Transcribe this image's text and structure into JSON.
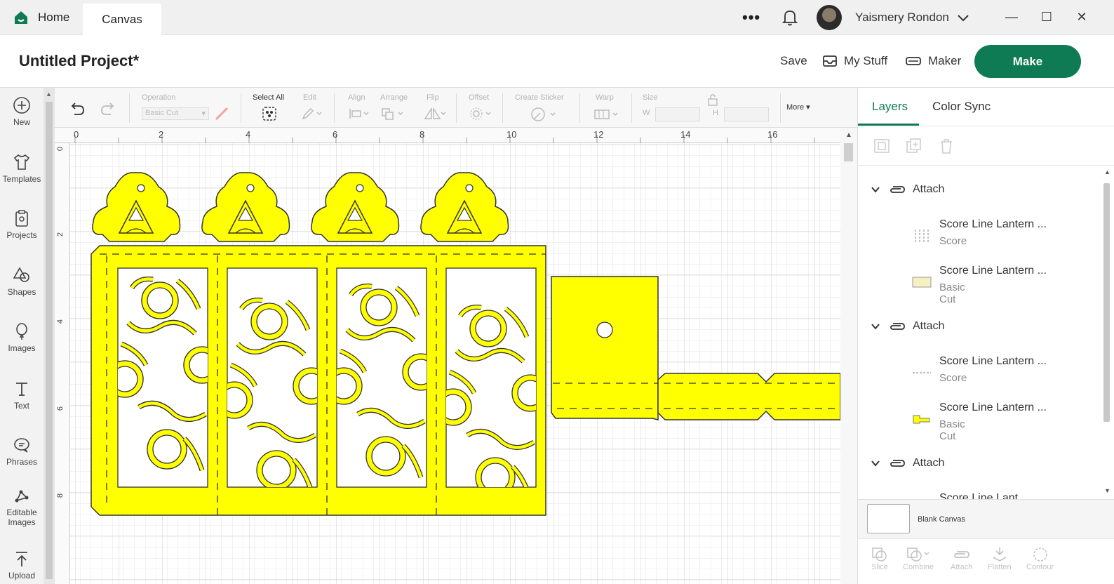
{
  "titlebar": {
    "tabs": [
      {
        "label": "Home"
      },
      {
        "label": "Canvas"
      }
    ],
    "more_glyph": "•••",
    "user_name": "Yaismery Rondon",
    "icons": [
      "home-icon",
      "bell-icon",
      "chevron-down-icon",
      "minimize-icon",
      "maximize-icon",
      "close-icon"
    ],
    "window_glyphs": {
      "minimize": "—",
      "maximize": "☐",
      "close": "✕"
    }
  },
  "header": {
    "project_title": "Untitled Project*",
    "save_label": "Save",
    "mystuff_label": "My Stuff",
    "maker_label": "Maker",
    "make_label": "Make",
    "accent_color": "#0f7b55"
  },
  "sidebar": {
    "items": [
      {
        "label": "New",
        "icon": "plus-circle-icon"
      },
      {
        "label": "Templates",
        "icon": "tshirt-icon"
      },
      {
        "label": "Projects",
        "icon": "clipboard-icon"
      },
      {
        "label": "Shapes",
        "icon": "shapes-icon"
      },
      {
        "label": "Images",
        "icon": "balloon-icon"
      },
      {
        "label": "Text",
        "icon": "text-icon"
      },
      {
        "label": "Phrases",
        "icon": "speech-bubble-icon"
      },
      {
        "label": "Editable Images",
        "icon": "editable-image-icon"
      },
      {
        "label": "Upload",
        "icon": "upload-icon"
      }
    ]
  },
  "toolbar": {
    "operation_label": "Operation",
    "operation_value": "Basic Cut",
    "select_all_label": "Select All",
    "edit_label": "Edit",
    "align_label": "Align",
    "arrange_label": "Arrange",
    "flip_label": "Flip",
    "offset_label": "Offset",
    "create_sticker_label": "Create Sticker",
    "warp_label": "Warp",
    "size_label": "Size",
    "w_label": "W",
    "h_label": "H",
    "more_label": "More"
  },
  "canvas": {
    "ruler_top": [
      "0",
      "2",
      "4",
      "6",
      "8",
      "10",
      "12",
      "14",
      "16"
    ],
    "ruler_left": [
      "0",
      "2",
      "4",
      "6",
      "8"
    ],
    "material_color": "#ffff00"
  },
  "right_panel": {
    "tabs": [
      {
        "label": "Layers"
      },
      {
        "label": "Color Sync"
      }
    ],
    "layer_icons": [
      "group-icon",
      "duplicate-icon",
      "trash-icon"
    ],
    "groups": [
      {
        "label": "Attach",
        "layers": [
          {
            "name": "Score Line Lantern ...",
            "type": "Score"
          },
          {
            "name": "Score Line Lantern ...",
            "type": "Basic Cut"
          }
        ]
      },
      {
        "label": "Attach",
        "layers": [
          {
            "name": "Score Line Lantern ...",
            "type": "Score"
          },
          {
            "name": "Score Line Lantern ...",
            "type": "Basic Cut"
          }
        ]
      },
      {
        "label": "Attach",
        "layers": [
          {
            "name": "Score Line Lant",
            "type": ""
          }
        ]
      }
    ],
    "blank_canvas_label": "Blank Canvas",
    "bottom_tools": [
      {
        "label": "Slice",
        "icon": "slice-icon"
      },
      {
        "label": "Combine",
        "icon": "combine-icon"
      },
      {
        "label": "Attach",
        "icon": "attach-icon"
      },
      {
        "label": "Flatten",
        "icon": "flatten-icon"
      },
      {
        "label": "Contour",
        "icon": "contour-icon"
      }
    ]
  }
}
